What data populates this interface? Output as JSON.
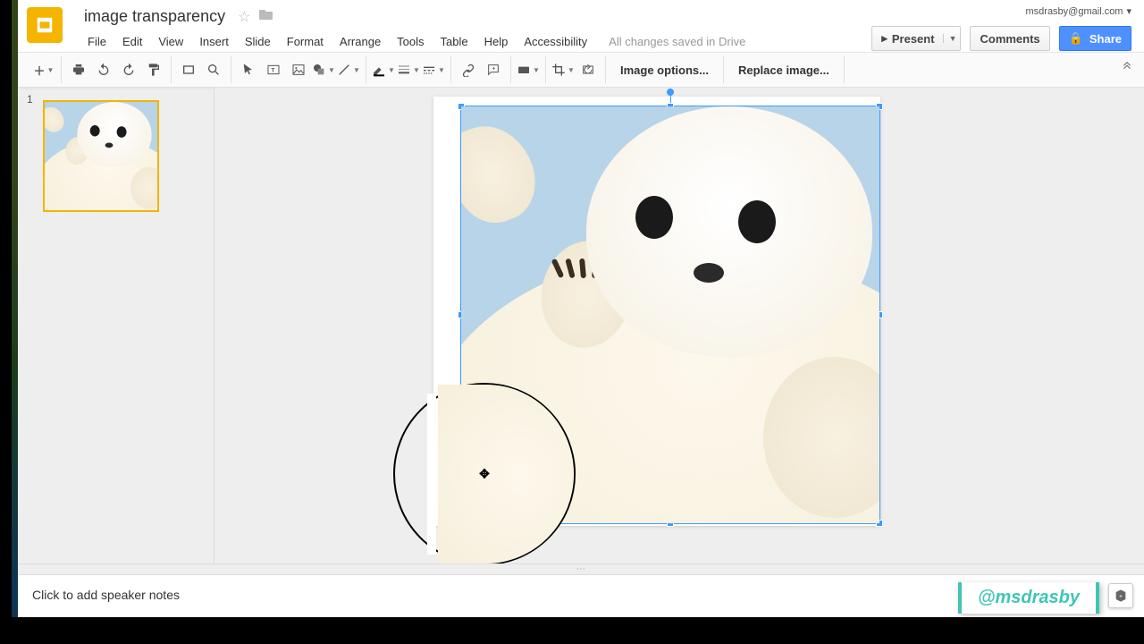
{
  "account": {
    "email": "msdrasby@gmail.com"
  },
  "document": {
    "title": "image transparency",
    "save_status": "All changes saved in Drive"
  },
  "menu": {
    "file": "File",
    "edit": "Edit",
    "view": "View",
    "insert": "Insert",
    "slide": "Slide",
    "format": "Format",
    "arrange": "Arrange",
    "tools": "Tools",
    "table": "Table",
    "help": "Help",
    "accessibility": "Accessibility"
  },
  "header_buttons": {
    "present": "Present",
    "comments": "Comments",
    "share": "Share"
  },
  "toolbar_labels": {
    "image_options": "Image options...",
    "replace_image": "Replace image..."
  },
  "filmstrip": {
    "slides": [
      {
        "number": "1"
      }
    ]
  },
  "speaker_notes": {
    "placeholder": "Click to add speaker notes"
  },
  "watermark": {
    "text": "@msdrasby"
  }
}
